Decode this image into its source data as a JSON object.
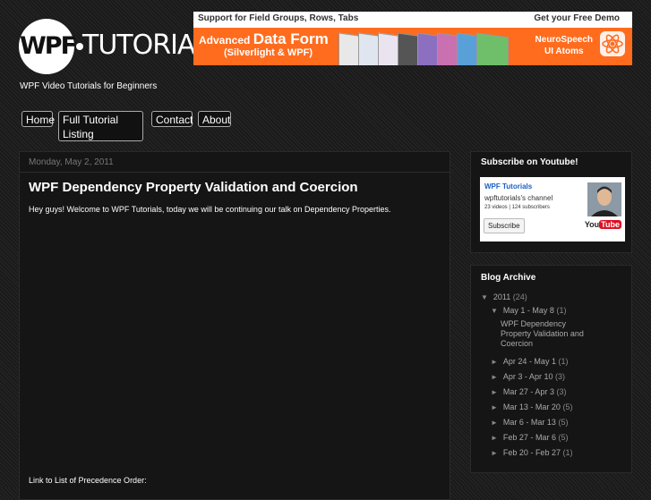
{
  "header": {
    "logo_left": "WPF",
    "logo_right": "TUTORIALS",
    "tagline": "WPF Video Tutorials for Beginners"
  },
  "banner": {
    "top_left": "Support for Field Groups, Rows, Tabs",
    "top_right": "Get your Free Demo",
    "title_prefix": "Advanced",
    "title_main": "Data Form",
    "subtitle": "(Silverlight & WPF)",
    "brand_line1": "NeuroSpeech",
    "brand_line2": "UI Atoms"
  },
  "nav": {
    "tabs": [
      {
        "label": "Home"
      },
      {
        "label": "Full Tutorial Listing"
      },
      {
        "label": "Contact"
      },
      {
        "label": "About"
      }
    ]
  },
  "post": {
    "date": "Monday, May 2, 2011",
    "title": "WPF Dependency Property Validation and Coercion",
    "body": "Hey guys! Welcome to WPF Tutorials, today we will be continuing our talk on Dependency Properties.",
    "link_text": "Link to List of Precedence Order:"
  },
  "sidebar": {
    "subscribe_title": "Subscribe on Youtube!",
    "youtube": {
      "name": "WPF Tutorials",
      "channel": "wpftutorials's channel",
      "stats": "23 videos | 124 subscribers",
      "subscribe_label": "Subscribe",
      "logo_you": "You",
      "logo_tube": "Tube"
    },
    "archive_title": "Blog Archive",
    "archive": {
      "year": {
        "label": "2011",
        "count": "(24)",
        "marker": "▼"
      },
      "open_week": {
        "label": "May 1 - May 8",
        "count": "(1)",
        "marker": "▼"
      },
      "open_post": "WPF Dependency Property Validation and Coercion",
      "weeks": [
        {
          "label": "Apr 24 - May 1",
          "count": "(1)",
          "marker": "►"
        },
        {
          "label": "Apr 3 - Apr 10",
          "count": "(3)",
          "marker": "►"
        },
        {
          "label": "Mar 27 - Apr 3",
          "count": "(3)",
          "marker": "►"
        },
        {
          "label": "Mar 13 - Mar 20",
          "count": "(5)",
          "marker": "►"
        },
        {
          "label": "Mar 6 - Mar 13",
          "count": "(5)",
          "marker": "►"
        },
        {
          "label": "Feb 27 - Mar 6",
          "count": "(5)",
          "marker": "►"
        },
        {
          "label": "Feb 20 - Feb 27",
          "count": "(1)",
          "marker": "►"
        }
      ]
    }
  }
}
